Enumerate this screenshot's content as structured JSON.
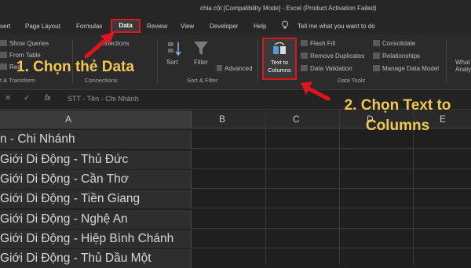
{
  "window": {
    "title": "chia cột  [Compatibility Mode]  -  Excel (Product Activation Failed)"
  },
  "tabs": [
    "sert",
    "Page Layout",
    "Formulas",
    "Data",
    "Review",
    "View",
    "Developer",
    "Help"
  ],
  "tell_me": "Tell me what you want to do",
  "ribbon": {
    "get": {
      "show_queries": "Show Queries",
      "from_table": "From Table",
      "recent": "Rec"
    },
    "connections": {
      "label": "onnections",
      "group": "Connections"
    },
    "get_transform_group": "t & Transform",
    "sort": "Sort",
    "filter": "Filter",
    "advanced": "Advanced",
    "sort_filter_group": "Sort & Filter",
    "text_to_columns_line1": "Text to",
    "text_to_columns_line2": "Columns",
    "flash_fill": "Flash Fill",
    "remove_duplicates": "Remove Duplicates",
    "data_validation": "Data Validation",
    "consolidate": "Consolidate",
    "relationships": "Relationships",
    "manage_data_model": "Manage Data Model",
    "data_tools_group": "Data Tools",
    "whatif_line1": "What",
    "whatif_line2": "Analys"
  },
  "formula_bar": {
    "fx": "fx",
    "content": "STT - Tên - Chi Nhánh"
  },
  "grid": {
    "columns": [
      "A",
      "B",
      "C",
      "D",
      "E"
    ],
    "rows": [
      "n - Chi Nhánh",
      "Giới Di Động - Thủ Đức",
      "Giới Di Động - Cần Thơ",
      "Giới Di Động - Tiền Giang",
      "Giới Di Động - Nghệ An",
      "Giới Di Động - Hiệp Bình Chánh",
      "Giới Di Động - Thủ Dầu Một"
    ]
  },
  "annotations": {
    "step1": "1. Chọn thẻ Data",
    "step2_line1": "2. Chọn Text to",
    "step2_line2": "Columns"
  },
  "colors": {
    "highlight_border": "#e0141c",
    "callout_text": "#f2c94c",
    "arrow": "#e0141c"
  }
}
